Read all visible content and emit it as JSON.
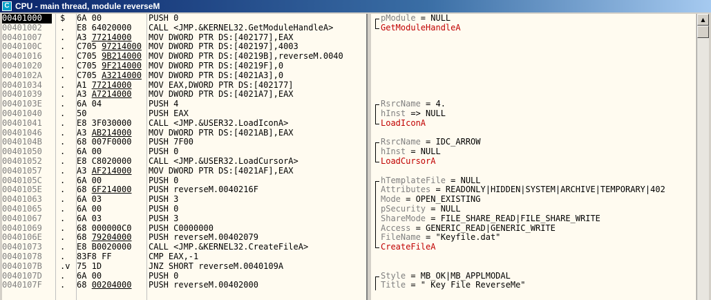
{
  "window": {
    "title": "CPU - main thread, module reverseM"
  },
  "disasm": [
    {
      "addr": "00401000",
      "mark": "$",
      "hex": [
        "6A 00"
      ],
      "asm": "PUSH 0",
      "sel": true
    },
    {
      "addr": "00401002",
      "mark": ".",
      "hex": [
        "E8 64020000"
      ],
      "asm": "CALL <JMP.&KERNEL32.GetModuleHandleA>"
    },
    {
      "addr": "00401007",
      "mark": ".",
      "hex": [
        "A3 ",
        "77214000"
      ],
      "asm": "MOV DWORD PTR DS:[402177],EAX"
    },
    {
      "addr": "0040100C",
      "mark": ".",
      "hex": [
        "C705 ",
        "97214000"
      ],
      "asm": "MOV DWORD PTR DS:[402197],4003"
    },
    {
      "addr": "00401016",
      "mark": ".",
      "hex": [
        "C705 ",
        "9B214000"
      ],
      "asm": "MOV DWORD PTR DS:[40219B],reverseM.0040"
    },
    {
      "addr": "00401020",
      "mark": ".",
      "hex": [
        "C705 ",
        "9F214000"
      ],
      "asm": "MOV DWORD PTR DS:[40219F],0"
    },
    {
      "addr": "0040102A",
      "mark": ".",
      "hex": [
        "C705 ",
        "A3214000"
      ],
      "asm": "MOV DWORD PTR DS:[4021A3],0"
    },
    {
      "addr": "00401034",
      "mark": ".",
      "hex": [
        "A1 ",
        "77214000"
      ],
      "asm": "MOV EAX,DWORD PTR DS:[402177]"
    },
    {
      "addr": "00401039",
      "mark": ".",
      "hex": [
        "A3 ",
        "A7214000"
      ],
      "asm": "MOV DWORD PTR DS:[4021A7],EAX"
    },
    {
      "addr": "0040103E",
      "mark": ".",
      "hex": [
        "6A 04"
      ],
      "asm": "PUSH 4"
    },
    {
      "addr": "00401040",
      "mark": ".",
      "hex": [
        "50"
      ],
      "asm": "PUSH EAX"
    },
    {
      "addr": "00401041",
      "mark": ".",
      "hex": [
        "E8 3F030000"
      ],
      "asm": "CALL <JMP.&USER32.LoadIconA>"
    },
    {
      "addr": "00401046",
      "mark": ".",
      "hex": [
        "A3 ",
        "AB214000"
      ],
      "asm": "MOV DWORD PTR DS:[4021AB],EAX"
    },
    {
      "addr": "0040104B",
      "mark": ".",
      "hex": [
        "68 007F0000"
      ],
      "asm": "PUSH 7F00"
    },
    {
      "addr": "00401050",
      "mark": ".",
      "hex": [
        "6A 00"
      ],
      "asm": "PUSH 0"
    },
    {
      "addr": "00401052",
      "mark": ".",
      "hex": [
        "E8 C8020000"
      ],
      "asm": "CALL <JMP.&USER32.LoadCursorA>"
    },
    {
      "addr": "00401057",
      "mark": ".",
      "hex": [
        "A3 ",
        "AF214000"
      ],
      "asm": "MOV DWORD PTR DS:[4021AF],EAX"
    },
    {
      "addr": "0040105C",
      "mark": ".",
      "hex": [
        "6A 00"
      ],
      "asm": "PUSH 0"
    },
    {
      "addr": "0040105E",
      "mark": ".",
      "hex": [
        "68 ",
        "6F214000"
      ],
      "asm": "PUSH reverseM.0040216F"
    },
    {
      "addr": "00401063",
      "mark": ".",
      "hex": [
        "6A 03"
      ],
      "asm": "PUSH 3"
    },
    {
      "addr": "00401065",
      "mark": ".",
      "hex": [
        "6A 00"
      ],
      "asm": "PUSH 0"
    },
    {
      "addr": "00401067",
      "mark": ".",
      "hex": [
        "6A 03"
      ],
      "asm": "PUSH 3"
    },
    {
      "addr": "00401069",
      "mark": ".",
      "hex": [
        "68 000000C0"
      ],
      "asm": "PUSH C0000000"
    },
    {
      "addr": "0040106E",
      "mark": ".",
      "hex": [
        "68 ",
        "79204000"
      ],
      "asm": "PUSH reverseM.00402079"
    },
    {
      "addr": "00401073",
      "mark": ".",
      "hex": [
        "E8 B0020000"
      ],
      "asm": "CALL <JMP.&KERNEL32.CreateFileA>"
    },
    {
      "addr": "00401078",
      "mark": ".",
      "hex": [
        "83F8 FF"
      ],
      "asm": "CMP EAX,-1"
    },
    {
      "addr": "0040107B",
      "mark": ".v",
      "hex": [
        "75 1D"
      ],
      "asm": "JNZ SHORT reverseM.0040109A"
    },
    {
      "addr": "0040107D",
      "mark": ".",
      "hex": [
        "6A 00"
      ],
      "asm": "PUSH 0"
    },
    {
      "addr": "0040107F",
      "mark": ".",
      "hex": [
        "68 ",
        "00204000"
      ],
      "asm": "PUSH reverseM.00402000"
    }
  ],
  "info": [
    {
      "k": "pModule",
      "v": " = NULL",
      "b": "top"
    },
    {
      "fn": "GetModuleHandleA",
      "b": "bot"
    },
    {},
    {},
    {},
    {},
    {},
    {},
    {},
    {
      "k": "RsrcName",
      "v": " = 4.",
      "b": "top"
    },
    {
      "k": "hInst",
      "v": " => NULL",
      "b": "mid"
    },
    {
      "fn": "LoadIconA",
      "b": "bot"
    },
    {},
    {
      "k": "RsrcName",
      "v": " = IDC_ARROW",
      "b": "top"
    },
    {
      "k": "hInst",
      "v": " = NULL",
      "b": "mid"
    },
    {
      "fn": "LoadCursorA",
      "b": "bot"
    },
    {},
    {
      "k": "hTemplateFile",
      "v": " = NULL",
      "b": "top"
    },
    {
      "k": "Attributes",
      "v": " = READONLY|HIDDEN|SYSTEM|ARCHIVE|TEMPORARY|402",
      "b": "mid"
    },
    {
      "k": "Mode",
      "v": " = OPEN_EXISTING",
      "b": "mid"
    },
    {
      "k": "pSecurity",
      "v": " = NULL",
      "b": "mid"
    },
    {
      "k": "ShareMode",
      "v": " = FILE_SHARE_READ|FILE_SHARE_WRITE",
      "b": "mid"
    },
    {
      "k": "Access",
      "v": " = GENERIC_READ|GENERIC_WRITE",
      "b": "mid"
    },
    {
      "k": "FileName",
      "v": " = \"Keyfile.dat\"",
      "b": "mid"
    },
    {
      "fn": "CreateFileA",
      "b": "bot"
    },
    {},
    {},
    {
      "k": "Style",
      "v": " = MB_OK|MB_APPLMODAL",
      "b": "top"
    },
    {
      "k": "Title",
      "v": " = \" Key File ReverseMe\"",
      "b": "mid"
    }
  ]
}
